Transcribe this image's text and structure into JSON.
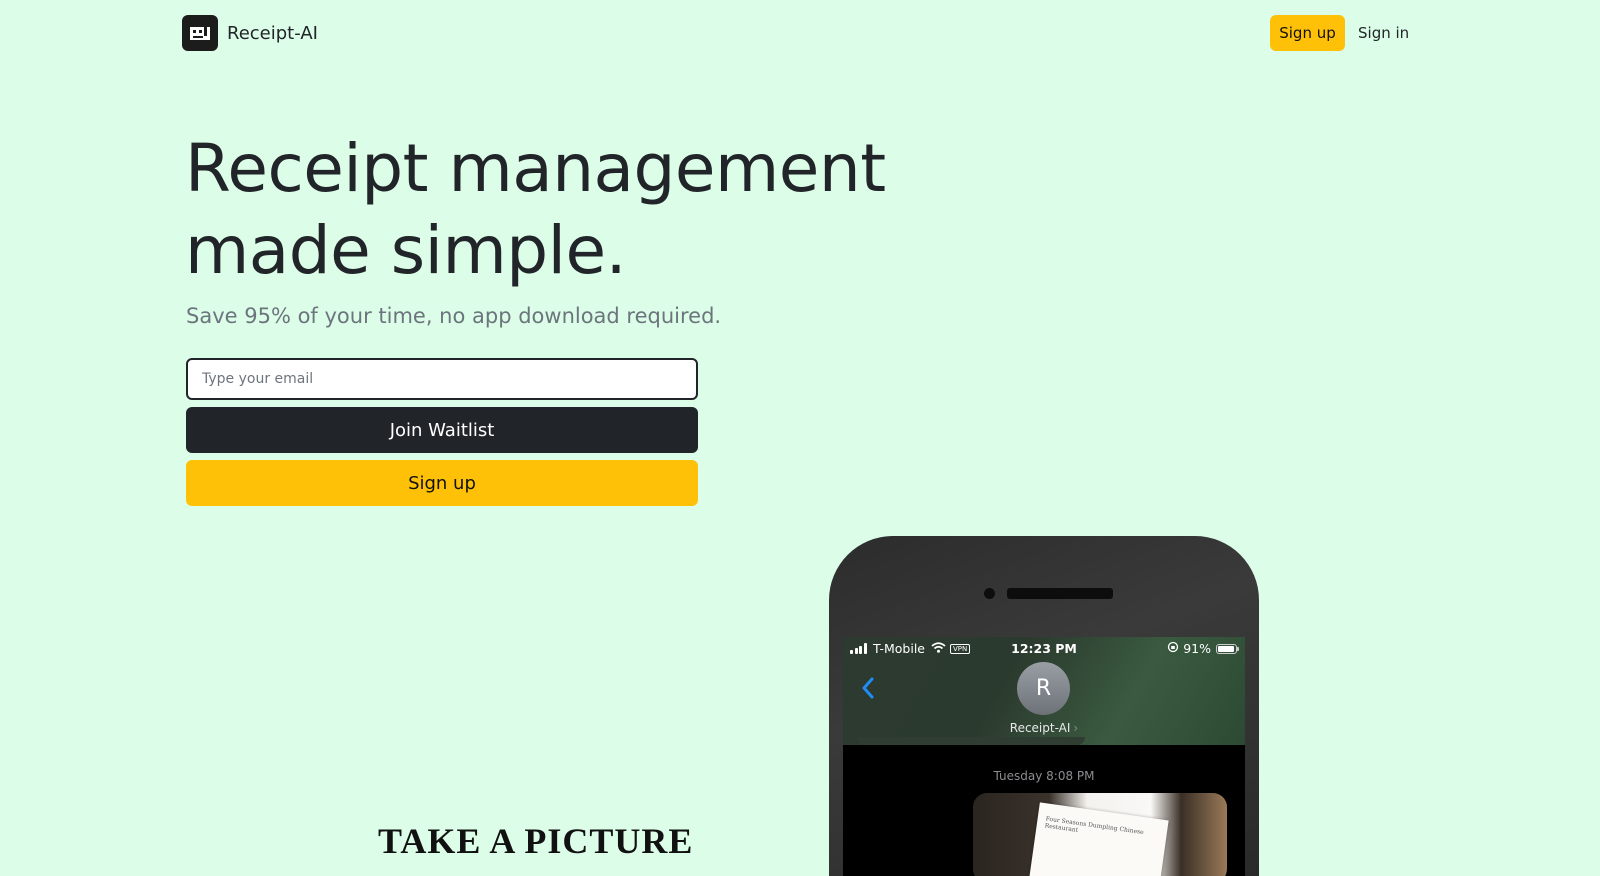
{
  "header": {
    "brand": "Receipt-AI",
    "signup_label": "Sign up",
    "signin_label": "Sign in"
  },
  "hero": {
    "title_line1": "Receipt management",
    "title_line2": "made simple.",
    "subtitle": "Save 95% of your time, no app download required.",
    "email_placeholder": "Type your email",
    "waitlist_label": "Join Waitlist",
    "signup_label": "Sign up",
    "step_heading": "TAKE A PICTURE"
  },
  "phone": {
    "status": {
      "carrier": "T-Mobile",
      "vpn": "VPN",
      "time": "12:23 PM",
      "battery": "91%"
    },
    "contact": {
      "initial": "R",
      "name": "Receipt-AI",
      "chevron": "›"
    },
    "message_date": "Tuesday 8:08 PM",
    "receipt_text": "Four Seasons Dumpling Chinese Restaurant"
  },
  "colors": {
    "background": "#dcfde7",
    "accent": "#ffc107",
    "dark": "#212529"
  }
}
